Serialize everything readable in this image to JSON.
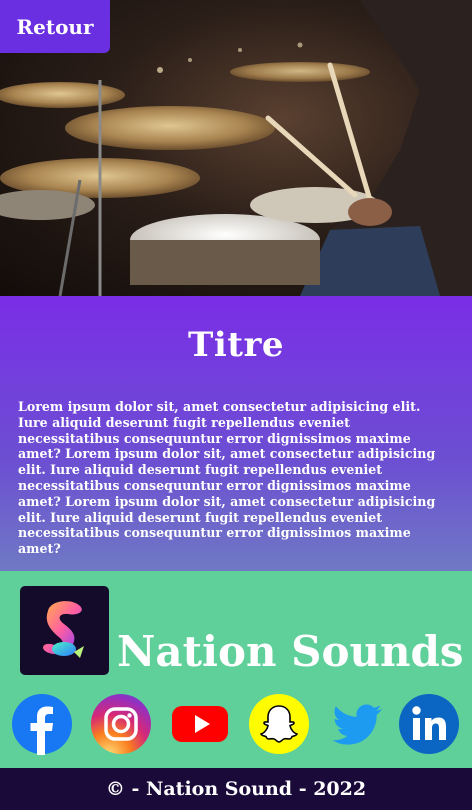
{
  "header": {
    "back_label": "Retour"
  },
  "main": {
    "title": "Titre",
    "body": "Lorem ipsum dolor sit, amet consectetur adipisicing elit. Iure aliquid deserunt fugit repellendus eveniet necessitatibus consequuntur error dignissimos maxime amet? Lorem ipsum dolor sit, amet consectetur adipisicing elit. Iure aliquid deserunt fugit repellendus eveniet necessitatibus consequuntur error dignissimos maxime amet? Lorem ipsum dolor sit, amet consectetur adipisicing elit. Iure aliquid deserunt fugit repellendus eveniet necessitatibus consequuntur error dignissimos maxime amet?"
  },
  "brand": {
    "name": "Nation Sounds"
  },
  "socials": [
    {
      "icon": "facebook-icon",
      "color": "#1877f2"
    },
    {
      "icon": "instagram-icon",
      "color": "#d62976"
    },
    {
      "icon": "youtube-icon",
      "color": "#ff0000"
    },
    {
      "icon": "snapchat-icon",
      "color": "#fffc00"
    },
    {
      "icon": "twitter-icon",
      "color": "#1d9bf0"
    },
    {
      "icon": "linkedin-icon",
      "color": "#0a66c2"
    }
  ],
  "footer": {
    "copyright": "© - Nation Sound - 2022"
  },
  "colors": {
    "accent": "#6a2fe0",
    "brand_band": "#5fd09a",
    "footer_bg": "#1a0a3a"
  }
}
